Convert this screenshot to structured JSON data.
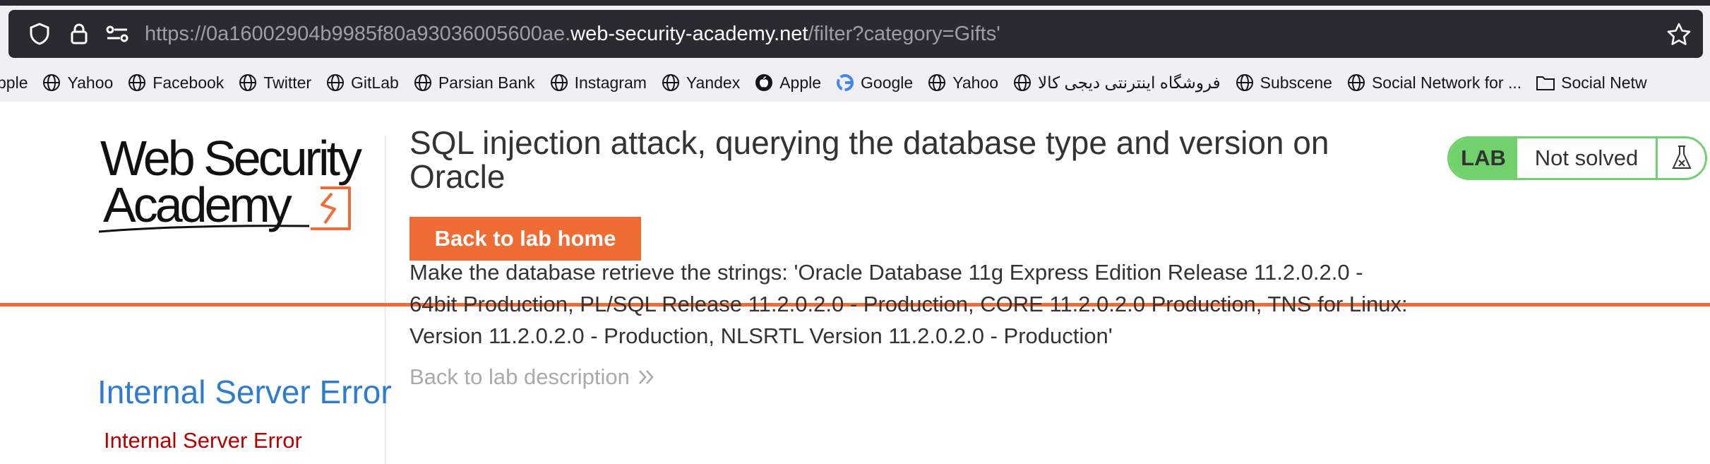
{
  "browser": {
    "url_prefix": "https://0a16002904b9985f80a93036005600ae.",
    "url_host": "web-security-academy.net",
    "url_path": "/filter?category=Gifts'",
    "icons": [
      "shield-icon",
      "lock-icon",
      "permissions-icon",
      "star-icon"
    ],
    "bookmarks": [
      {
        "label": "pple",
        "icon": "apple-icon"
      },
      {
        "label": "Yahoo",
        "icon": "globe-icon"
      },
      {
        "label": "Facebook",
        "icon": "globe-icon"
      },
      {
        "label": "Twitter",
        "icon": "globe-icon"
      },
      {
        "label": "GitLab",
        "icon": "globe-icon"
      },
      {
        "label": "Parsian Bank",
        "icon": "globe-icon"
      },
      {
        "label": "Instagram",
        "icon": "globe-icon"
      },
      {
        "label": "Yandex",
        "icon": "globe-icon"
      },
      {
        "label": "Apple",
        "icon": "apple-icon"
      },
      {
        "label": "Google",
        "icon": "google-icon"
      },
      {
        "label": "Yahoo",
        "icon": "globe-icon"
      },
      {
        "label": "فروشگاه اینترنتی دیجی کالا",
        "icon": "globe-icon"
      },
      {
        "label": "Subscene",
        "icon": "globe-icon"
      },
      {
        "label": "Social Network for ...",
        "icon": "globe-icon"
      },
      {
        "label": "Social Netw",
        "icon": "folder-icon"
      }
    ]
  },
  "logo": {
    "line1": "Web Security",
    "line2": "Academy"
  },
  "lab": {
    "title": "SQL injection attack, querying the database type and version on Oracle",
    "back_home_label": "Back to lab home",
    "description": "Make the database retrieve the strings: 'Oracle Database 11g Express Edition Release 11.2.0.2.0 - 64bit Production, PL/SQL Release 11.2.0.2.0 - Production, CORE 11.2.0.2.0 Production, TNS for Linux: Version 11.2.0.2.0 - Production, NLSRTL Version 11.2.0.2.0 - Production'",
    "back_desc_label": "Back to lab description",
    "status_tag": "LAB",
    "status_text": "Not solved"
  },
  "error": {
    "title": "Internal Server Error",
    "message": "Internal Server Error"
  },
  "colors": {
    "accent_orange": "#ef6c35",
    "lab_green": "#70d16d",
    "error_blue": "#2e7bcf",
    "error_red": "#b50000"
  }
}
